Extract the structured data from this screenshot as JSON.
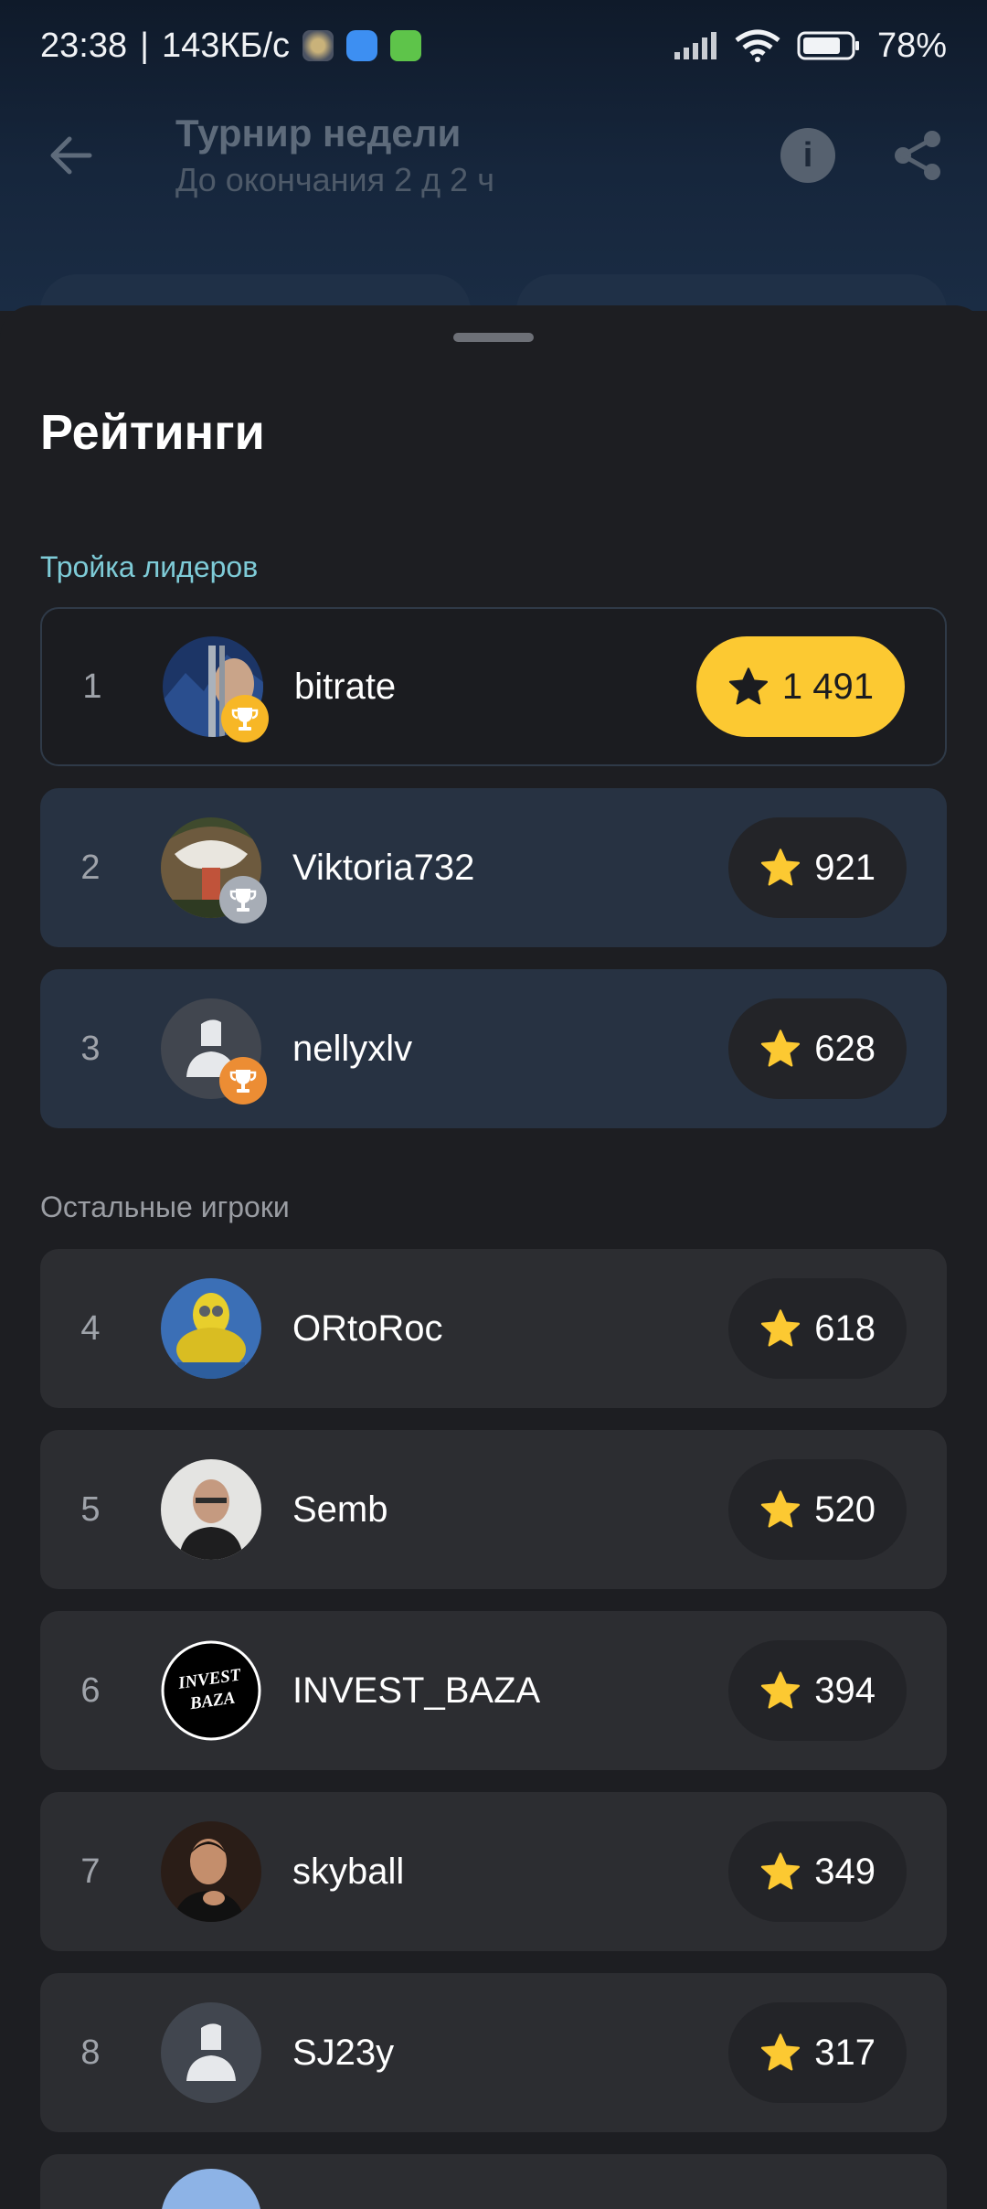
{
  "status_bar": {
    "time": "23:38",
    "speed": "143КБ/с",
    "battery": "78%"
  },
  "header": {
    "title": "Турнир недели",
    "subtitle": "До окончания 2 д 2 ч",
    "info_label": "i"
  },
  "sheet": {
    "title": "Рейтинги",
    "leaders_label": "Тройка лидеров",
    "others_label": "Остальные игроки"
  },
  "leaders": [
    {
      "rank": "1",
      "name": "bitrate",
      "score": "1 491"
    },
    {
      "rank": "2",
      "name": "Viktoria732",
      "score": "921"
    },
    {
      "rank": "3",
      "name": "nellyxlv",
      "score": "628"
    }
  ],
  "others": [
    {
      "rank": "4",
      "name": "ORtoRoc",
      "score": "618"
    },
    {
      "rank": "5",
      "name": "Semb",
      "score": "520"
    },
    {
      "rank": "6",
      "name": "INVEST_BAZA",
      "score": "394"
    },
    {
      "rank": "7",
      "name": "skyball",
      "score": "349"
    },
    {
      "rank": "8",
      "name": "SJ23y",
      "score": "317"
    }
  ],
  "avatar_text": {
    "invest_line1": "INVEST",
    "invest_line2": "BAZA"
  },
  "colors": {
    "accent_gold": "#fcc932",
    "leaders_label": "#7ecbd7",
    "trophy_gold": "#f7b726",
    "trophy_silver": "#a7adb6",
    "trophy_bronze": "#ec8d34"
  },
  "icons": {
    "back": "arrow-left-icon",
    "info": "info-icon",
    "share": "share-icon",
    "star": "star-icon",
    "trophy": "trophy-icon"
  }
}
